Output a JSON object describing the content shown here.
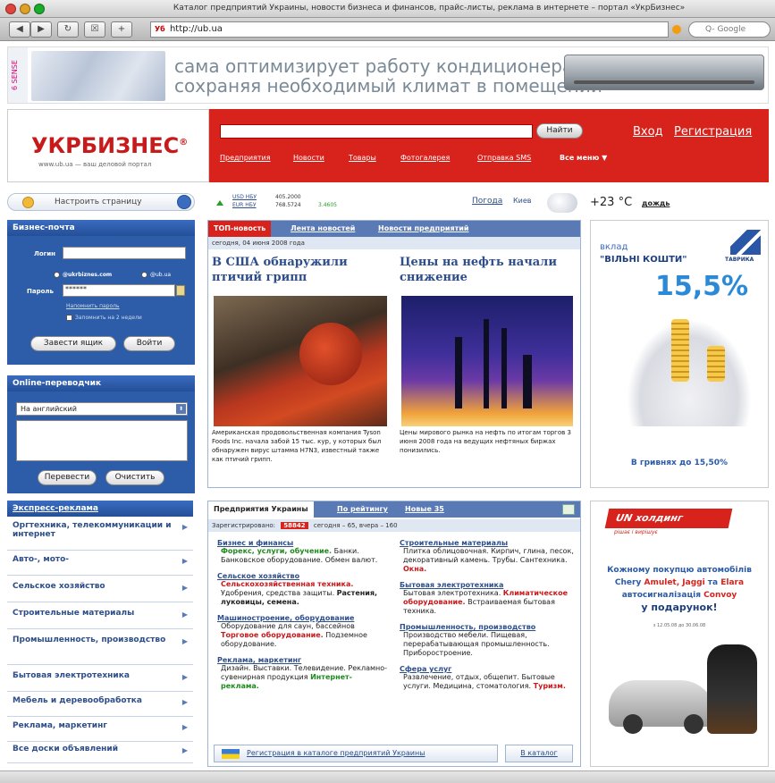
{
  "browser": {
    "title": "Каталог предприятий Украины, новости бизнеса и финансов, прайс-листы, реклама в интернете – портал «УкрБизнес»",
    "url": "http://ub.ua",
    "search_placeholder": "Q- Google",
    "url_badge": "Уб"
  },
  "banner": {
    "brand": "6 SENSE",
    "line1": "сама оптимизирует работу кондиционера,",
    "line2": "сохраняя необходимый климат в помещении"
  },
  "logo": {
    "name": "УКРБИЗНЕС",
    "mark": "®",
    "tagline": "www.ub.ua — ваш деловой портал"
  },
  "header": {
    "find_label": "Найти",
    "login_link": "Вход",
    "register_link": "Регистрация",
    "nav": [
      "Предприятия",
      "Новости",
      "Товары",
      "Фотогалерея",
      "Отправка SMS",
      "Все меню ▼"
    ]
  },
  "customize": {
    "label": "Настроить страницу"
  },
  "rates": {
    "usd_label": "USD НБУ",
    "usd_value": "405.2000",
    "eur_label": "EUR НБУ",
    "eur_value": "768.5724",
    "eur_change": "3.4605",
    "weather_link": "Погода",
    "city": "Киев",
    "temp": "+23 °С",
    "condition": "дождь"
  },
  "mail": {
    "title": "Бизнес-почта",
    "login_label": "Логин",
    "domain1": "@ukrbiznes.com",
    "domain2": "@ub.ua",
    "password_label": "Пароль",
    "password_value": "******",
    "forgot": "Напомнить пароль",
    "remember": "Запомнить на 2 недели",
    "create_button": "Завести ящик",
    "enter_button": "Войти"
  },
  "translator": {
    "title": "Online-переводчик",
    "language": "На английский",
    "translate_button": "Перевести",
    "clear_button": "Очистить"
  },
  "express": {
    "title": "Экспресс-реклама",
    "items": [
      "Оргтехника, телекоммуникации и интернет",
      "Авто-, мото-",
      "Сельское хозяйство",
      "Строительные материалы",
      "Промышленность, производство",
      "Бытовая электротехника",
      "Мебель и деревообработка",
      "Реклама, маркетинг",
      "Все доски объявлений"
    ]
  },
  "news": {
    "tabs": [
      "ТОП-новость",
      "Лента новостей",
      "Новости предприятий"
    ],
    "date": "сегодня, 04 июня 2008 года",
    "story1": {
      "headline": "В США обнаружили птичий грипп",
      "text": "Американская продовольственная компания Tyson Foods Inc. начала забой 15 тыс. кур, у которых был обнаружен вирус штамма H7N3, известный также как птичий грипп."
    },
    "story2": {
      "headline": "Цены на нефть начали снижение",
      "text": "Цены мирового рынка на нефть по итогам торгов 3 июня 2008 года на ведущих нефтяных биржах понизились."
    }
  },
  "catalog": {
    "tabs": [
      "Предприятия Украины",
      "По рейтингу",
      "Новые 35"
    ],
    "registered_label": "Зарегистрировано:",
    "registered_count": "58842",
    "today": "сегодня – 65, вчера – 160",
    "left": [
      {
        "title": "Бизнес и финансы",
        "lines": [
          [
            "Форекс, услуги, обучение.",
            "g"
          ],
          [
            "Банки. Банковское оборудование. Обмен валют.",
            ""
          ]
        ]
      },
      {
        "title": "Сельское хозяйство",
        "lines": [
          [
            "Сельскохозяйственная техника.",
            "r"
          ],
          [
            "Удобрения, средства защиты.",
            ""
          ],
          [
            "Растения, луковицы, семена.",
            "b"
          ]
        ]
      },
      {
        "title": "Машиностроение, оборудование",
        "lines": [
          [
            "Оборудование для саун, бассейнов",
            ""
          ],
          [
            "Торговое оборудование.",
            "r"
          ],
          [
            "Подземное оборудование.",
            ""
          ]
        ]
      },
      {
        "title": "Реклама, маркетинг",
        "lines": [
          [
            "Дизайн. Выставки. Телевидение.",
            ""
          ],
          [
            "Рекламно-сувенирная продукция",
            ""
          ],
          [
            "Интернет-реклама.",
            "g"
          ]
        ]
      }
    ],
    "right": [
      {
        "title": "Строительные материалы",
        "lines": [
          [
            "Плитка облицовочная. Кирпич, глина, песок, декоративный камень. Трубы. Сантехника.",
            ""
          ],
          [
            "Окна.",
            "r"
          ]
        ]
      },
      {
        "title": "Бытовая электротехника",
        "lines": [
          [
            "Бытовая электротехника.",
            ""
          ],
          [
            "Климатическое оборудование.",
            "r"
          ],
          [
            "Встраиваемая бытовая техника.",
            ""
          ]
        ]
      },
      {
        "title": "Промышленность, производство",
        "lines": [
          [
            "Производство мебели. Пищевая, перерабатывающая промышленность. Приборостроение.",
            ""
          ]
        ]
      },
      {
        "title": "Сфера услуг",
        "lines": [
          [
            "Развлечение, отдых, обще­пит. Бытовые услуги. Медицина, стоматология.",
            ""
          ],
          [
            "Туризм.",
            "r"
          ]
        ]
      }
    ],
    "register_button": "Регистрация в каталоге предприятий Украины",
    "catalog_button": "В каталог"
  },
  "ad1": {
    "label1": "вклад",
    "label2": "\"ВІЛЬНІ КОШТИ\"",
    "bank": "ТАВРИКА",
    "rate": "15,5%",
    "footer": "В гривнях до 15,50%"
  },
  "ad2": {
    "logo": "UN холдинг",
    "sublogo": "рішає і вирішує",
    "l1": "Кожному покупцю автомобілів",
    "l2a": "Chery ",
    "l2b": "Amulet, Jaggi",
    "l2c": " та ",
    "l2d": "Elara",
    "l3a": "автосигналізація ",
    "l3b": "Convoy",
    "l4": "у подарунок!",
    "small": "з 12.05.08 до 30.06.08"
  },
  "colors": {
    "brand_red": "#d8221c",
    "panel_blue": "#2d5ca8",
    "link_blue": "#2d4e8a"
  }
}
